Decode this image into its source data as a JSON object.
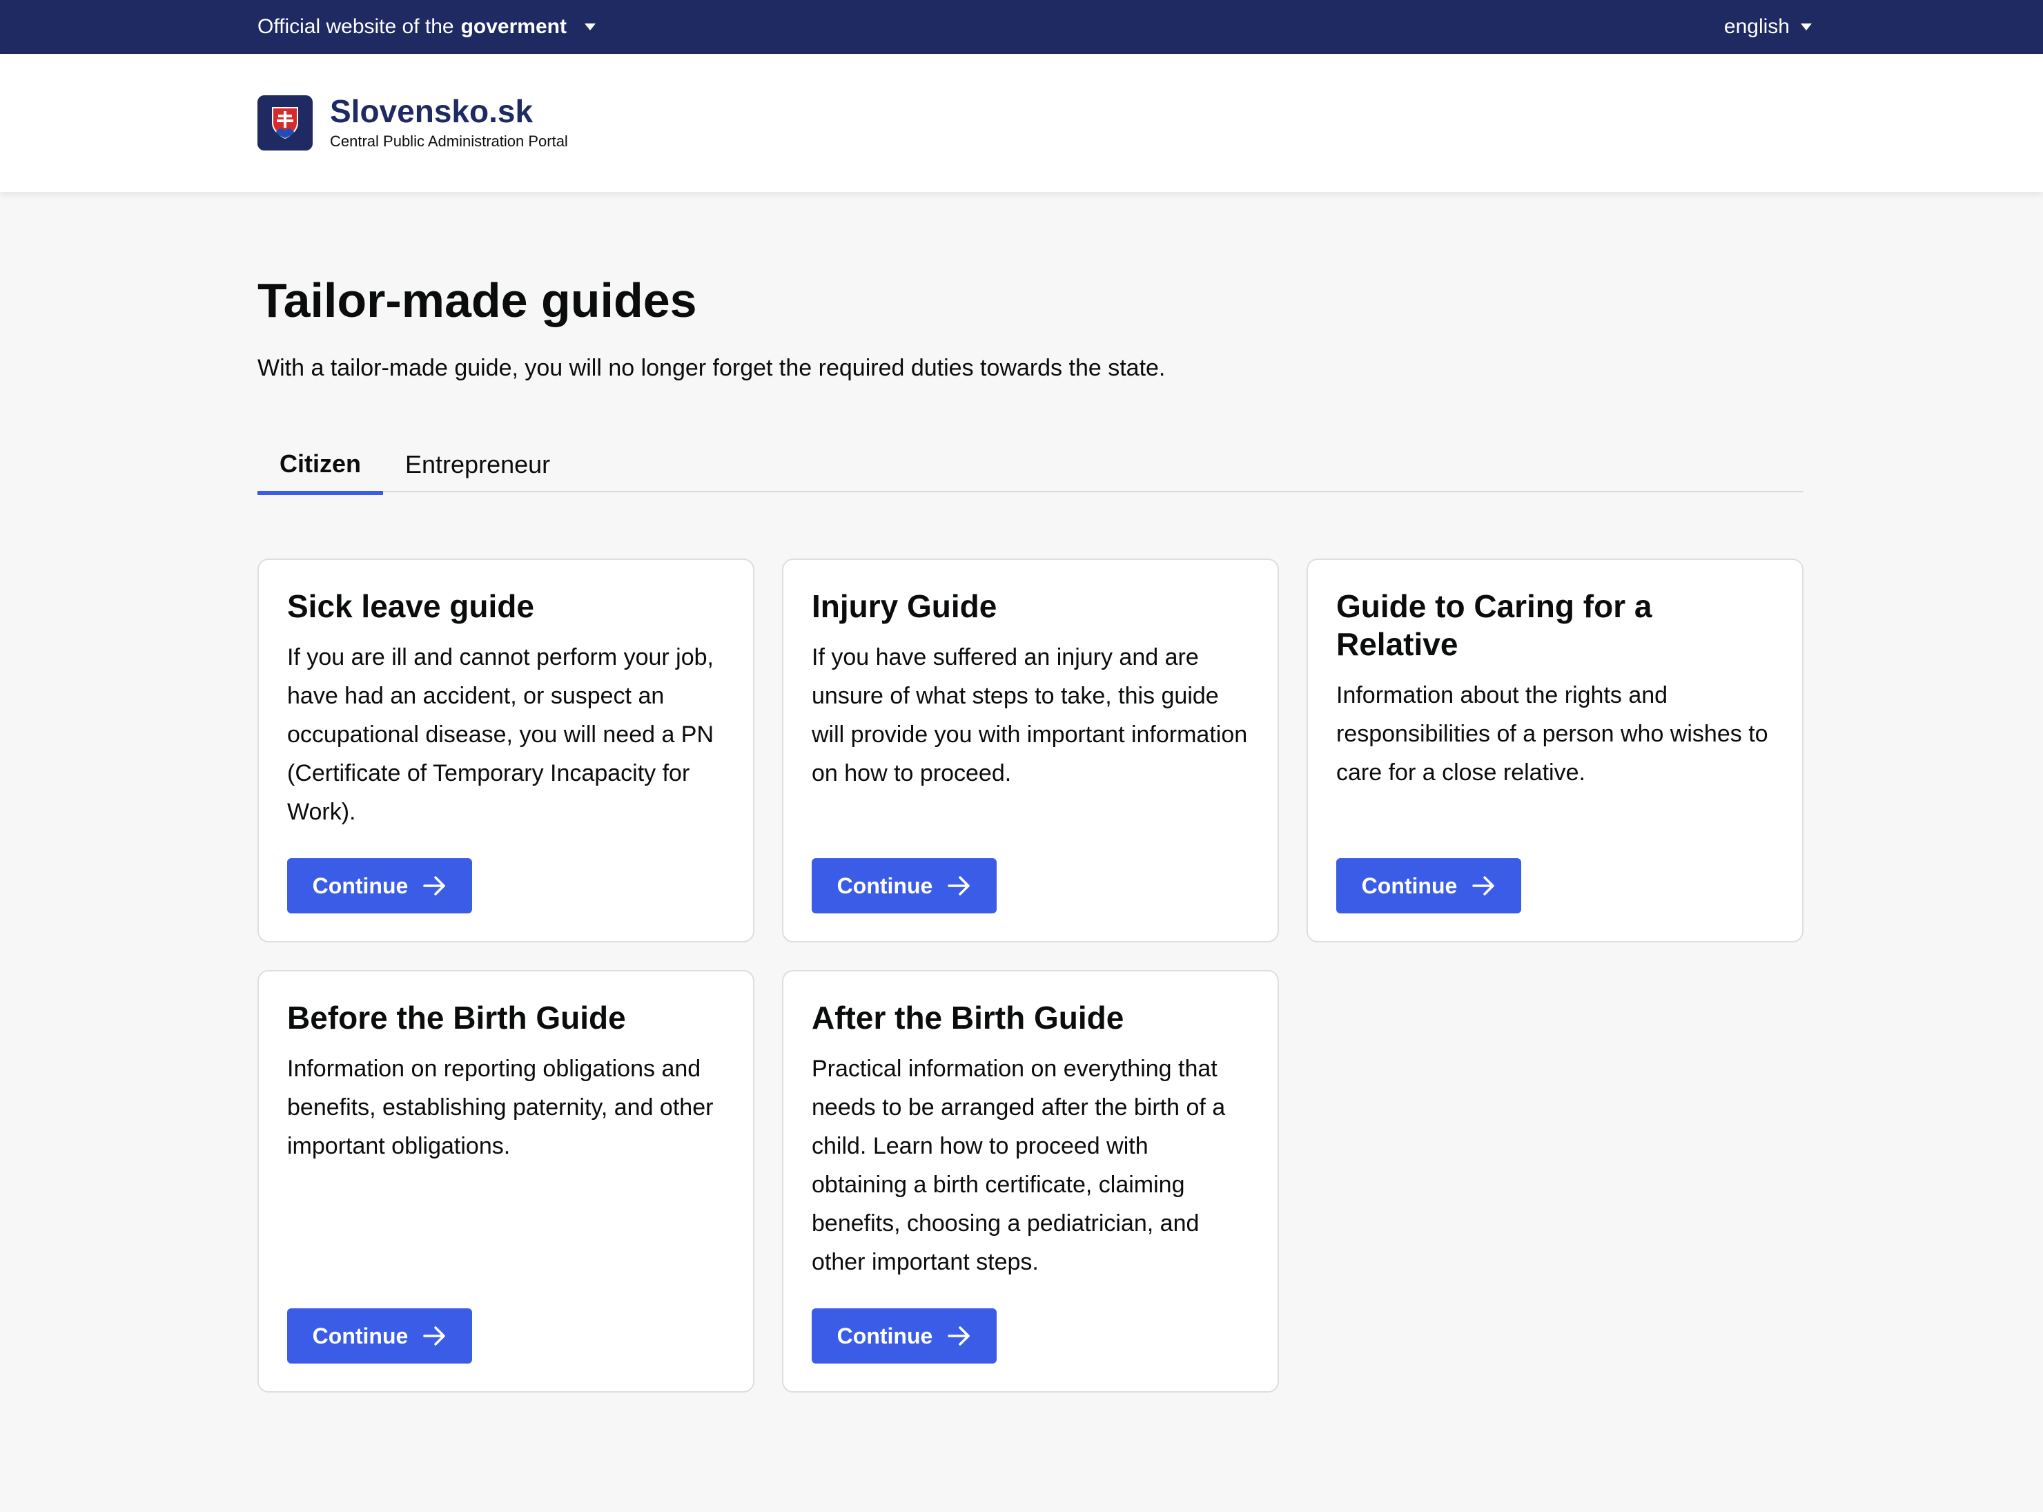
{
  "topbar": {
    "official_prefix": "Official website of the",
    "official_bold": "goverment",
    "language": "english"
  },
  "brand": {
    "name": "Slovensko.sk",
    "subtitle": "Central Public Administration Portal"
  },
  "page": {
    "title": "Tailor-made guides",
    "lead": "With a tailor-made guide, you will no longer forget the required duties towards the state."
  },
  "tabs": [
    {
      "label": "Citizen",
      "active": true
    },
    {
      "label": "Entrepreneur",
      "active": false
    }
  ],
  "cards": [
    {
      "title": "Sick leave guide",
      "description": "If you are ill and cannot perform your job, have had an accident, or suspect an occupational disease, you will need a PN (Certificate of Temporary Incapacity for Work).",
      "button": "Continue"
    },
    {
      "title": "Injury Guide",
      "description": "If you have suffered an injury and are unsure of what steps to take, this guide will provide you with important information on how to proceed.",
      "button": "Continue"
    },
    {
      "title": "Guide to Caring for a Relative",
      "description": "Information about the rights and responsibilities of a person who wishes to care for a close relative.",
      "button": "Continue"
    },
    {
      "title": "Before the Birth Guide",
      "description": "Information on reporting obligations and benefits, establishing paternity, and other important obligations.",
      "button": "Continue"
    },
    {
      "title": "After the Birth Guide",
      "description": "Practical information on everything that needs to be arranged after the birth of a child. Learn how to proceed with obtaining a birth certificate, claiming benefits, choosing a pediatrician, and other important steps.",
      "button": "Continue"
    }
  ],
  "colors": {
    "navy": "#1f2a62",
    "accent": "#3b5ce6",
    "background": "#f7f7f7"
  },
  "icons": {
    "logo": "slovak-coat-of-arms-icon",
    "dropdown": "caret-down-icon",
    "button": "arrow-right-icon"
  }
}
